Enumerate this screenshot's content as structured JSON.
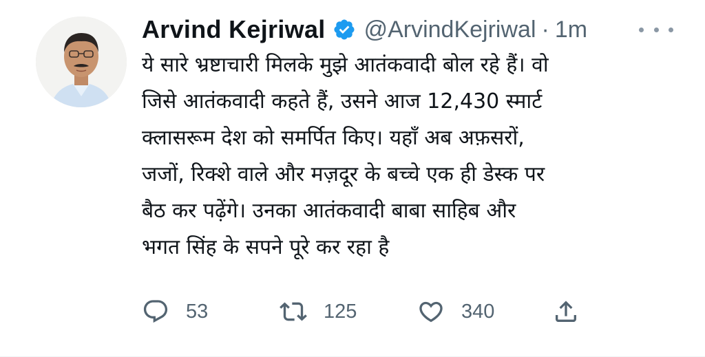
{
  "author": {
    "name": "Arvind Kejriwal",
    "handle": "@ArvindKejriwal",
    "separator": "·",
    "time": "1m",
    "verified": true,
    "verified_color": "#1d9bf0"
  },
  "tweet": {
    "lines": [
      "ये सारे भ्रष्टाचारी मिलके मुझे आतंकवादी बोल रहे हैं। वो",
      "जिसे आतंकवादी कहते हैं, उसने आज 12,430 स्मार्ट",
      "क्लासरूम देश को समर्पित किए। यहाँ अब अफ़सरों,",
      "जजों, रिक्शे वाले और मज़दूर के बच्चे एक ही डेस्क पर",
      "बैठ कर पढ़ेंगे। उनका आतंकवादी बाबा साहिब और",
      "भगत सिंह के सपने पूरे कर रहा है"
    ]
  },
  "actions": {
    "reply_count": "53",
    "retweet_count": "125",
    "like_count": "340"
  },
  "icons": {
    "verified": "verified-badge-icon",
    "more": "more-icon",
    "reply": "reply-icon",
    "retweet": "retweet-icon",
    "like": "heart-icon",
    "share": "share-icon"
  },
  "colors": {
    "text": "#0f1419",
    "secondary": "#536471"
  }
}
